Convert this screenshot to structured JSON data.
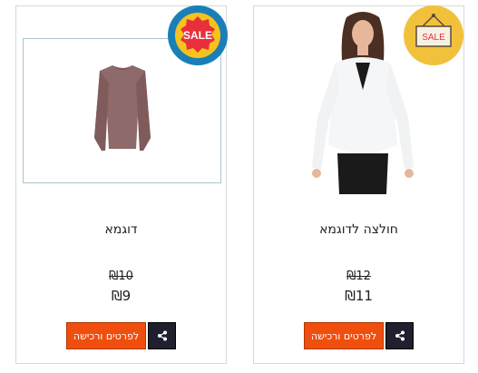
{
  "products": [
    {
      "title": "דוגמא",
      "old_price": "₪10",
      "new_price": "₪9",
      "buy_label": "לפרטים ורכישה",
      "badge_text": "SALE",
      "share_icon": "share-icon"
    },
    {
      "title": "חולצה לדוגמא",
      "old_price": "₪12",
      "new_price": "₪11",
      "buy_label": "לפרטים ורכישה",
      "badge_text": "SALE",
      "share_icon": "share-icon"
    }
  ],
  "colors": {
    "buy_button": "#f04e0e",
    "share_button": "#1f1f2e",
    "badge_left_outer": "#1a7fb8",
    "badge_left_inner": "#e8303a",
    "badge_right": "#f2c13c"
  }
}
